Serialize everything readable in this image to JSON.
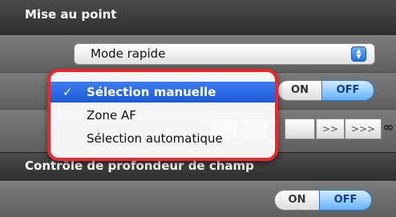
{
  "focus_section": {
    "title": "Mise au point",
    "mode_select": {
      "value": "Mode rapide"
    },
    "af_toggle": {
      "on_label": "ON",
      "off_label": "OFF",
      "selected": "OFF"
    },
    "step_buttons": {
      "large_step_label": ">>>",
      "infinity_label": "∞"
    }
  },
  "dropdown_menu": {
    "items": [
      {
        "label": "Sélection manuelle",
        "checked": true
      },
      {
        "label": "Zone AF",
        "checked": false
      },
      {
        "label": "Sélection automatique",
        "checked": false
      }
    ],
    "check_mark": "✓"
  },
  "dof_section": {
    "title": "Contrôle de profondeur de champ",
    "toggle": {
      "on_label": "ON",
      "off_label": "OFF",
      "selected": "OFF"
    }
  },
  "colors": {
    "menu_highlight": "#e8282c",
    "selection_blue": "#2a66e0",
    "off_blue": "#63b0ff"
  }
}
